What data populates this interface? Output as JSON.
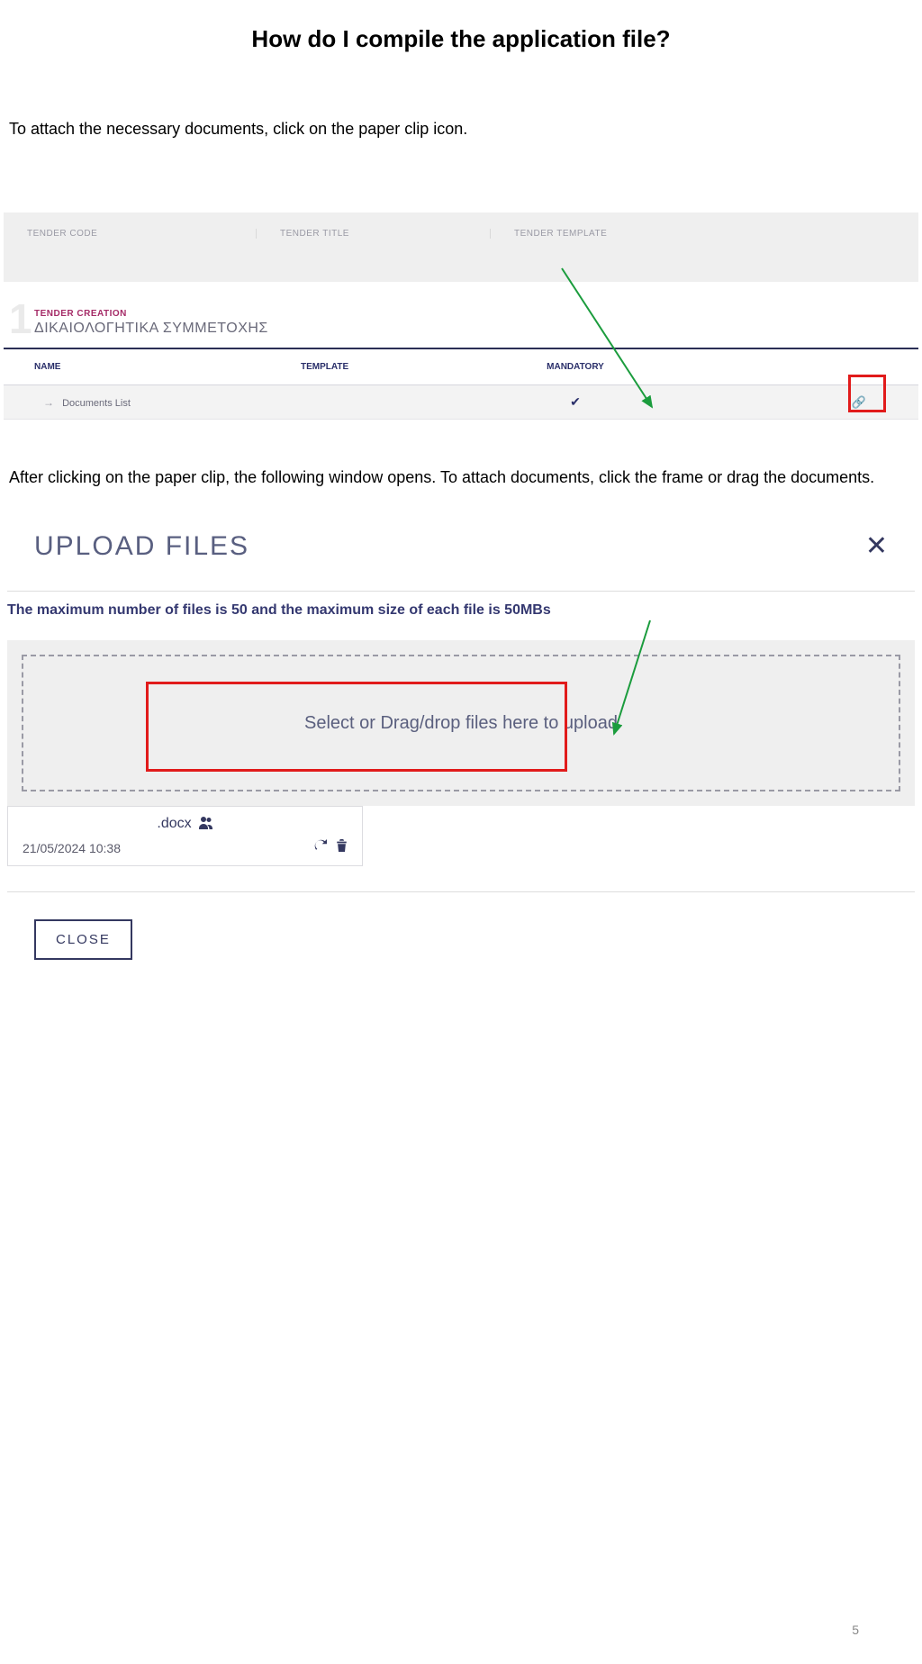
{
  "page": {
    "title": "How do I compile the application file?",
    "instruction1": "To attach the necessary documents, click on the paper clip icon.",
    "instruction2": "After clicking on the paper clip, the following window opens. To attach documents, click the frame or drag the documents.",
    "page_number": "5"
  },
  "tender": {
    "header": {
      "code": "TENDER CODE",
      "title": "TENDER TITLE",
      "template": "TENDER TEMPLATE"
    },
    "step_number": "1",
    "creation_label": "TENDER CREATION",
    "subtitle": "ΔΙΚΑΙΟΛΟΓΗΤΙΚΑ ΣΥΜΜΕΤΟΧΗΣ",
    "table": {
      "header_name": "NAME",
      "header_template": "TEMPLATE",
      "header_mandatory": "MANDATORY",
      "row_name": "Documents List"
    }
  },
  "upload": {
    "title": "UPLOAD FILES",
    "note": "The maximum number of files is 50 and the maximum size of each file is 50MBs",
    "dropzone_text": "Select or Drag/drop files here to upload",
    "file": {
      "name": ".docx",
      "timestamp": "21/05/2024 10:38"
    },
    "close_btn": "CLOSE"
  }
}
